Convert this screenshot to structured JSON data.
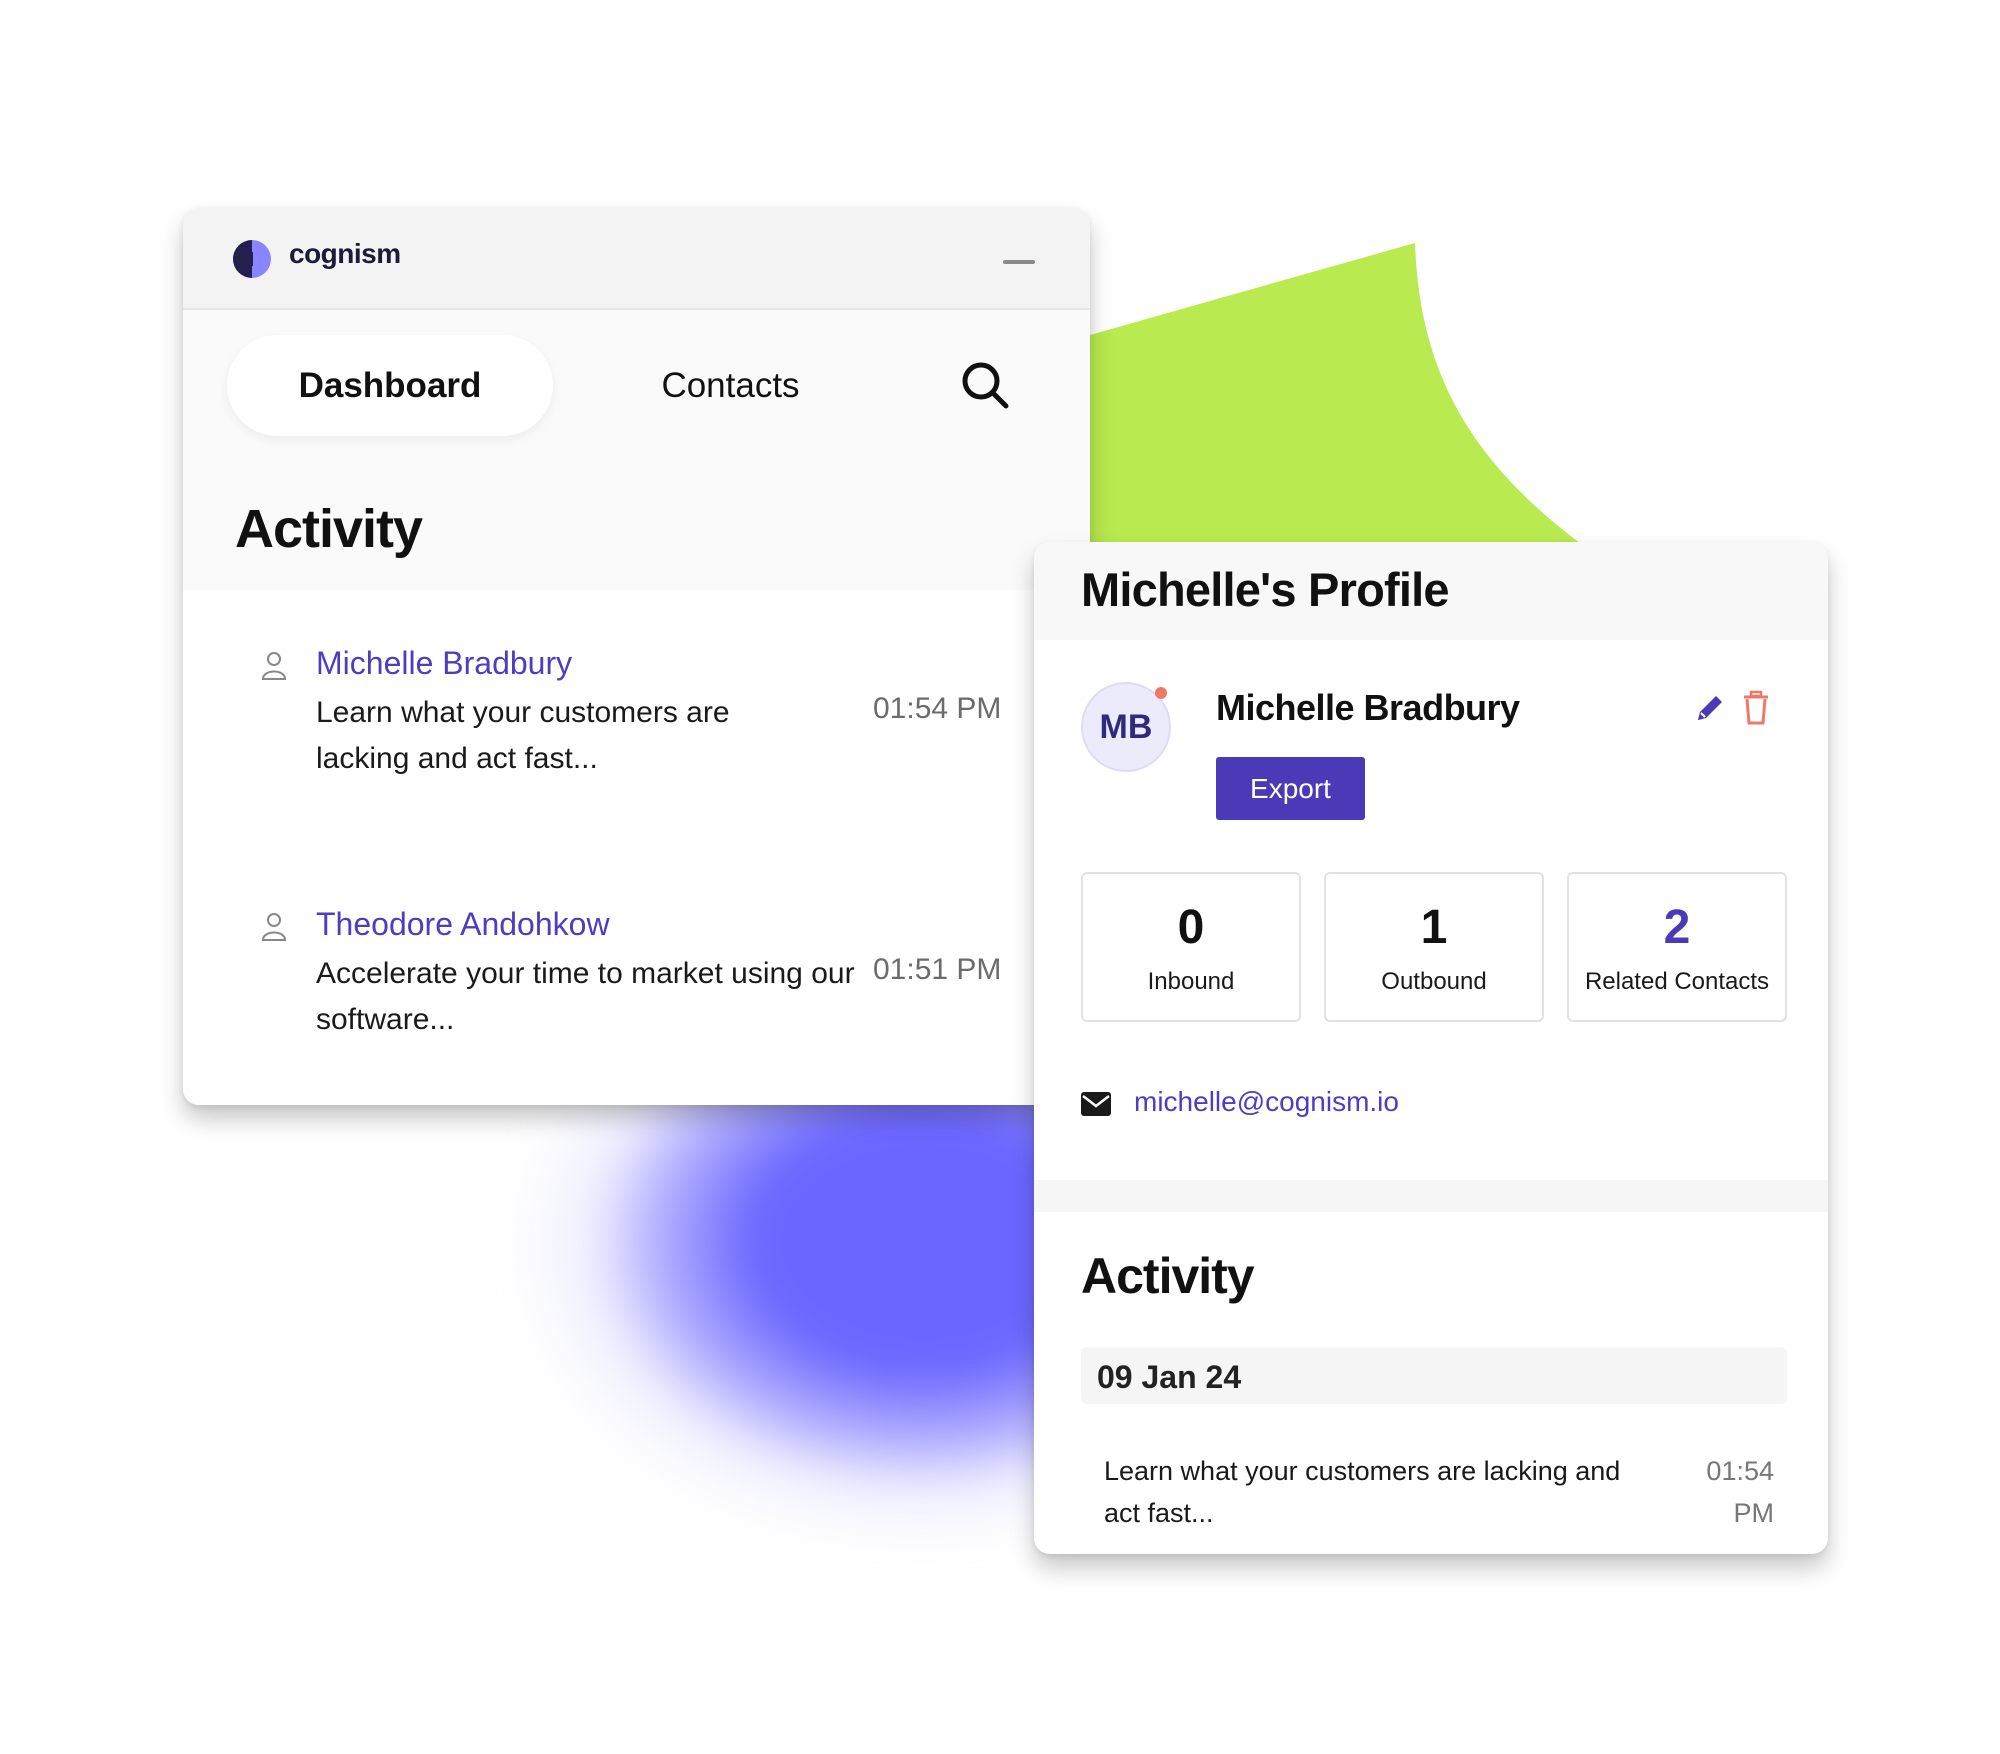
{
  "app": {
    "brand": "cognism",
    "colors": {
      "accent": "#4b3ab8",
      "link": "#4f3dbf",
      "green_decor": "#b9ea4f",
      "purple_decor": "#6b66ff",
      "danger": "#f07866"
    }
  },
  "dashboard_window": {
    "tabs": [
      {
        "label": "Dashboard",
        "active": true
      },
      {
        "label": "Contacts",
        "active": false
      }
    ],
    "icons": {
      "search": "search-icon",
      "minimize": "minimize-icon"
    },
    "activity_title": "Activity",
    "activity_items": [
      {
        "name": "Michelle Bradbury",
        "description": "Learn what your customers are lacking and act fast...",
        "time": "01:54 PM"
      },
      {
        "name": "Theodore Andohkow",
        "description": "Accelerate your time to market using our software...",
        "time": "01:51 PM"
      }
    ]
  },
  "profile": {
    "title": "Michelle's Profile",
    "initials": "MB",
    "name": "Michelle Bradbury",
    "export_label": "Export",
    "stats": [
      {
        "value": "0",
        "label": "Inbound"
      },
      {
        "value": "1",
        "label": "Outbound"
      },
      {
        "value": "2",
        "label": "Related Contacts"
      }
    ],
    "email": "michelle@cognism.io",
    "activity_title": "Activity",
    "activity_date": "09 Jan 24",
    "activity_item": {
      "description": "Learn what your customers are lacking and act fast...",
      "time": "01:54 PM"
    }
  }
}
